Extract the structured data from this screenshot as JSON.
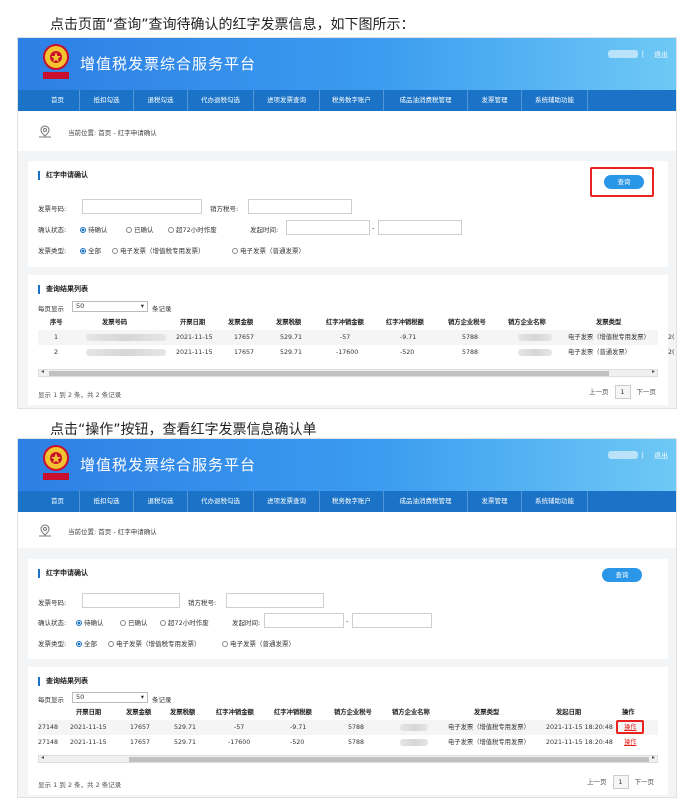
{
  "captions": {
    "step1": "点击页面“查询”查询待确认的红字发票信息，如下图所示：",
    "step2": "点击“操作”按钮，查看红字发票信息确认单"
  },
  "colors": {
    "accent": "#1a73c7",
    "highlight": "#e8231f",
    "button": "#2996e8"
  },
  "header": {
    "site_title": "增值税发票综合服务平台",
    "logout": "退出",
    "divider": "|"
  },
  "nav": {
    "items": [
      "首页",
      "抵扣勾选",
      "退税勾选",
      "代办退税勾选",
      "进项发票查询",
      "税务数字账户",
      "成品油消费税管理",
      "发票管理",
      "系统辅助功能"
    ]
  },
  "breadcrumb": {
    "prefix": "当前位置:",
    "path": "首页 - 红字申请确认"
  },
  "filter": {
    "title": "红字申请确认",
    "query_label": "查询",
    "invoice_no_label": "发票号码:",
    "seller_tax_label": "销方税号:",
    "status_label": "确认状态:",
    "status_options": [
      "待确认",
      "已确认",
      "超72小时作废"
    ],
    "start_time_label": "发起时间:",
    "range_sep": "-",
    "type_label": "发票类型:",
    "type_options": [
      "全部",
      "电子发票（增值税专用发票）",
      "电子发票（普通发票）"
    ]
  },
  "results": {
    "title": "查询结果列表",
    "page_size_prefix": "每页显示",
    "page_size_value": "50",
    "page_size_suffix": "条记录",
    "footer": "显示 1 到 2 条，共 2 条记录",
    "prev": "上一页",
    "page_number": "1",
    "next": "下一页"
  },
  "table1": {
    "headers": [
      "序号",
      "发票号码",
      "开票日期",
      "发票金额",
      "发票税额",
      "红字冲销金额",
      "红字冲销税额",
      "销方企业税号",
      "销方企业名称",
      "发票类型"
    ],
    "trailing": "2(",
    "rows": [
      [
        "1",
        "",
        "2021-11-15",
        "17657",
        "529.71",
        "-57",
        "-9.71",
        "5788",
        "",
        "电子发票（增值税专用发票）"
      ],
      [
        "2",
        "",
        "2021-11-15",
        "17657",
        "529.71",
        "-17600",
        "-520",
        "5788",
        "",
        "电子发票（普通发票）"
      ]
    ]
  },
  "table2": {
    "headers": [
      "开票日期",
      "发票金额",
      "发票税额",
      "红字冲销金额",
      "红字冲销税额",
      "销方企业税号",
      "销方企业名称",
      "发票类型",
      "发起日期",
      "操作"
    ],
    "rows": [
      [
        "27148",
        "2021-11-15",
        "17657",
        "529.71",
        "-57",
        "-9.71",
        "5788",
        "",
        "电子发票（增值税专用发票）",
        "2021-11-15 18:20:48",
        "操作"
      ],
      [
        "27148",
        "2021-11-15",
        "17657",
        "529.71",
        "-17600",
        "-520",
        "5788",
        "",
        "电子发票（增值税专用发票）",
        "2021-11-15 18:20:48",
        "操作"
      ]
    ]
  }
}
